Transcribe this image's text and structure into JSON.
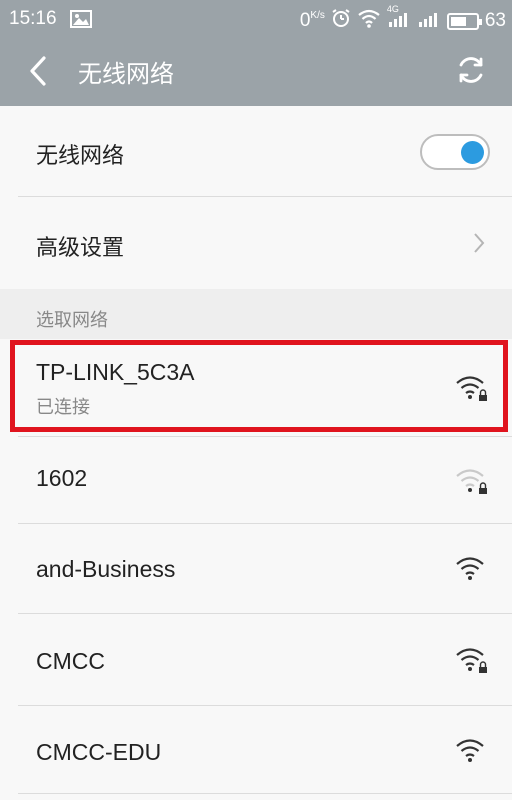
{
  "status_bar": {
    "time": "15:16",
    "net_speed": "0",
    "net_speed_unit": "K/s",
    "signal_badge": "4G",
    "battery": "63"
  },
  "nav": {
    "title": "无线网络"
  },
  "settings": {
    "wifi_toggle_label": "无线网络",
    "wifi_toggle_on": true,
    "advanced_label": "高级设置"
  },
  "section": {
    "label": "选取网络"
  },
  "networks": [
    {
      "name": "TP-LINK_5C3A",
      "status": "已连接",
      "secured": true,
      "signal": "strong"
    },
    {
      "name": "1602",
      "status": "",
      "secured": true,
      "signal": "weak"
    },
    {
      "name": "and-Business",
      "status": "",
      "secured": false,
      "signal": "strong"
    },
    {
      "name": "CMCC",
      "status": "",
      "secured": true,
      "signal": "strong"
    },
    {
      "name": "CMCC-EDU",
      "status": "",
      "secured": false,
      "signal": "strong"
    }
  ],
  "colors": {
    "header_bg": "#9ba3a8",
    "toggle_knob": "#2c9be0",
    "highlight_border": "#e0141e"
  }
}
